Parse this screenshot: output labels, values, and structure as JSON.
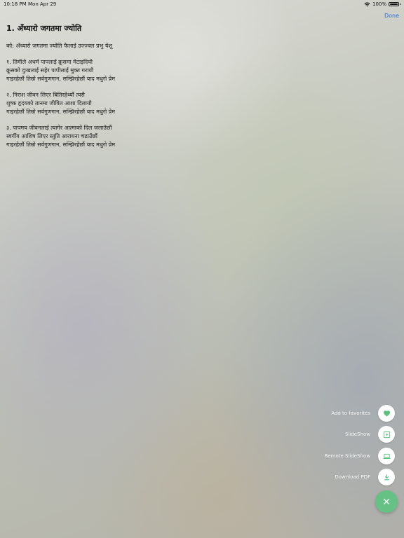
{
  "status_bar": {
    "time": "10:18 PM",
    "date": "Mon Apr 29",
    "battery": "100%",
    "battery_level": 1.0,
    "icons": [
      "wifi-icon",
      "battery-icon"
    ]
  },
  "nav": {
    "done_label": "Done"
  },
  "song": {
    "title": "1. अँध्यारो जगतमा ज्योति",
    "stanzas": [
      [
        "को: अँध्यारो जगतमा ज्योति फैलाई उज्ज्वल प्रभु येशू"
      ],
      [
        "१. तिमीले अधर्म पापलाई क्रूसमा मेटाइदियौ",
        "क्रूसको दुःखलाई सहेर पापीलाई मुक्त गरायौ",
        "गाइरहेछौं तिम्रो सर्वगुणगान, सम्झिरहेछौं याद मधुरो प्रेम"
      ],
      [
        "२. निराश जीवन लिएर बितिरहेथ्यौं त्यसै",
        "शुष्क हृदयको तानमा जीवित आशा दिलायौ",
        "गाइरहेछौं तिम्रो सर्वगुणगान, सम्झिरहेछौं याद मधुरो प्रेम"
      ],
      [
        "३. पापमय जीवनलाई त्यागेर आत्माको दिल जलाउँछौं",
        "स्वर्गीय आशिष लिएर स्तुति आराधना चढाउँछौं",
        "गाइरहेछौं तिम्रो सर्वगुणगान, सम्झिरहेछौं याद मधुरो प्रेम"
      ]
    ]
  },
  "fab_menu": {
    "items": [
      {
        "label": "Add to favorites",
        "icon": "heart-icon"
      },
      {
        "label": "SlideShow",
        "icon": "slideshow-icon"
      },
      {
        "label": "Remote SlideShow",
        "icon": "laptop-icon"
      },
      {
        "label": "Download PDF",
        "icon": "download-icon"
      }
    ],
    "close_icon": "close-icon"
  },
  "colors": {
    "accent_green": "#66c184",
    "link_blue": "#2f6fd6",
    "fab_icon_green": "#5cbf7c"
  }
}
